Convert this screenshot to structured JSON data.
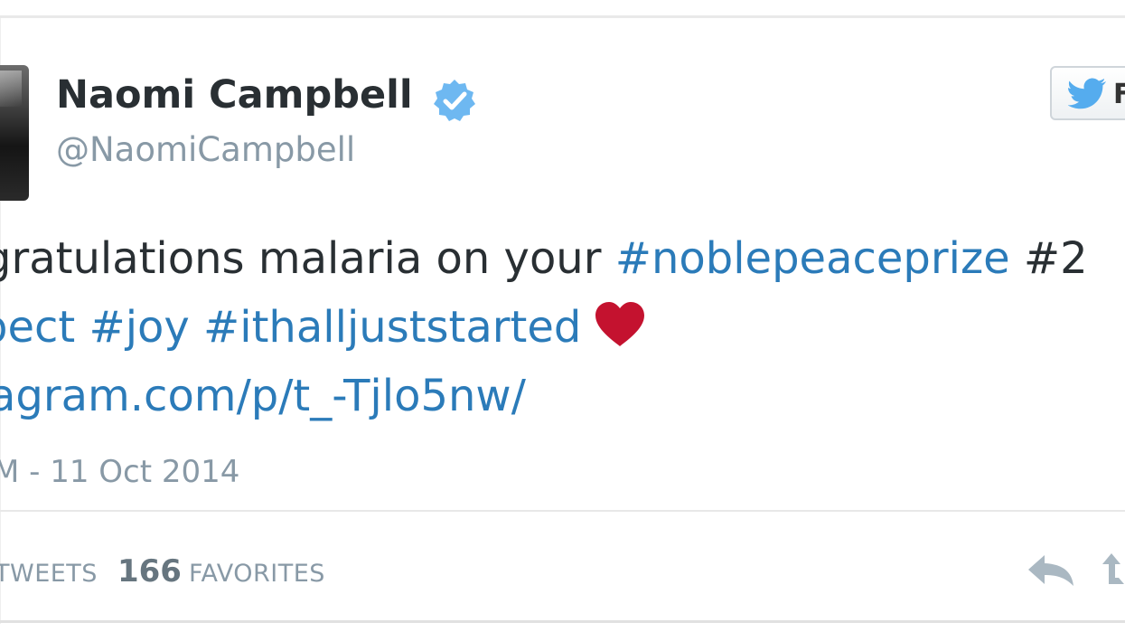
{
  "author": {
    "name": "Naomi Campbell",
    "handle": "@NaomiCampbell",
    "verified_icon": "verified-badge-icon"
  },
  "follow_button": {
    "icon": "twitter-bird-icon",
    "label_visible": "F"
  },
  "tweet": {
    "line1_text": "gratulations malaria on your ",
    "line1_hashtag1": "#noblepeaceprize",
    "line1_hashtag2_partial": " #2",
    "line2_hashtags": "pect #joy #ithalljuststarted",
    "line2_emoji": "heart-emoji",
    "line3_link": "agram.com/p/t_-Tjlo5nw/",
    "timestamp": "M - 11 Oct 2014"
  },
  "stats": {
    "retweets_label": "TWEETS",
    "favorites_count": "166",
    "favorites_label": "FAVORITES"
  },
  "colors": {
    "link": "#2b7bb9",
    "text": "#292f33",
    "muted": "#8899a6",
    "verified": "#55acee",
    "heart": "#c4122f"
  }
}
